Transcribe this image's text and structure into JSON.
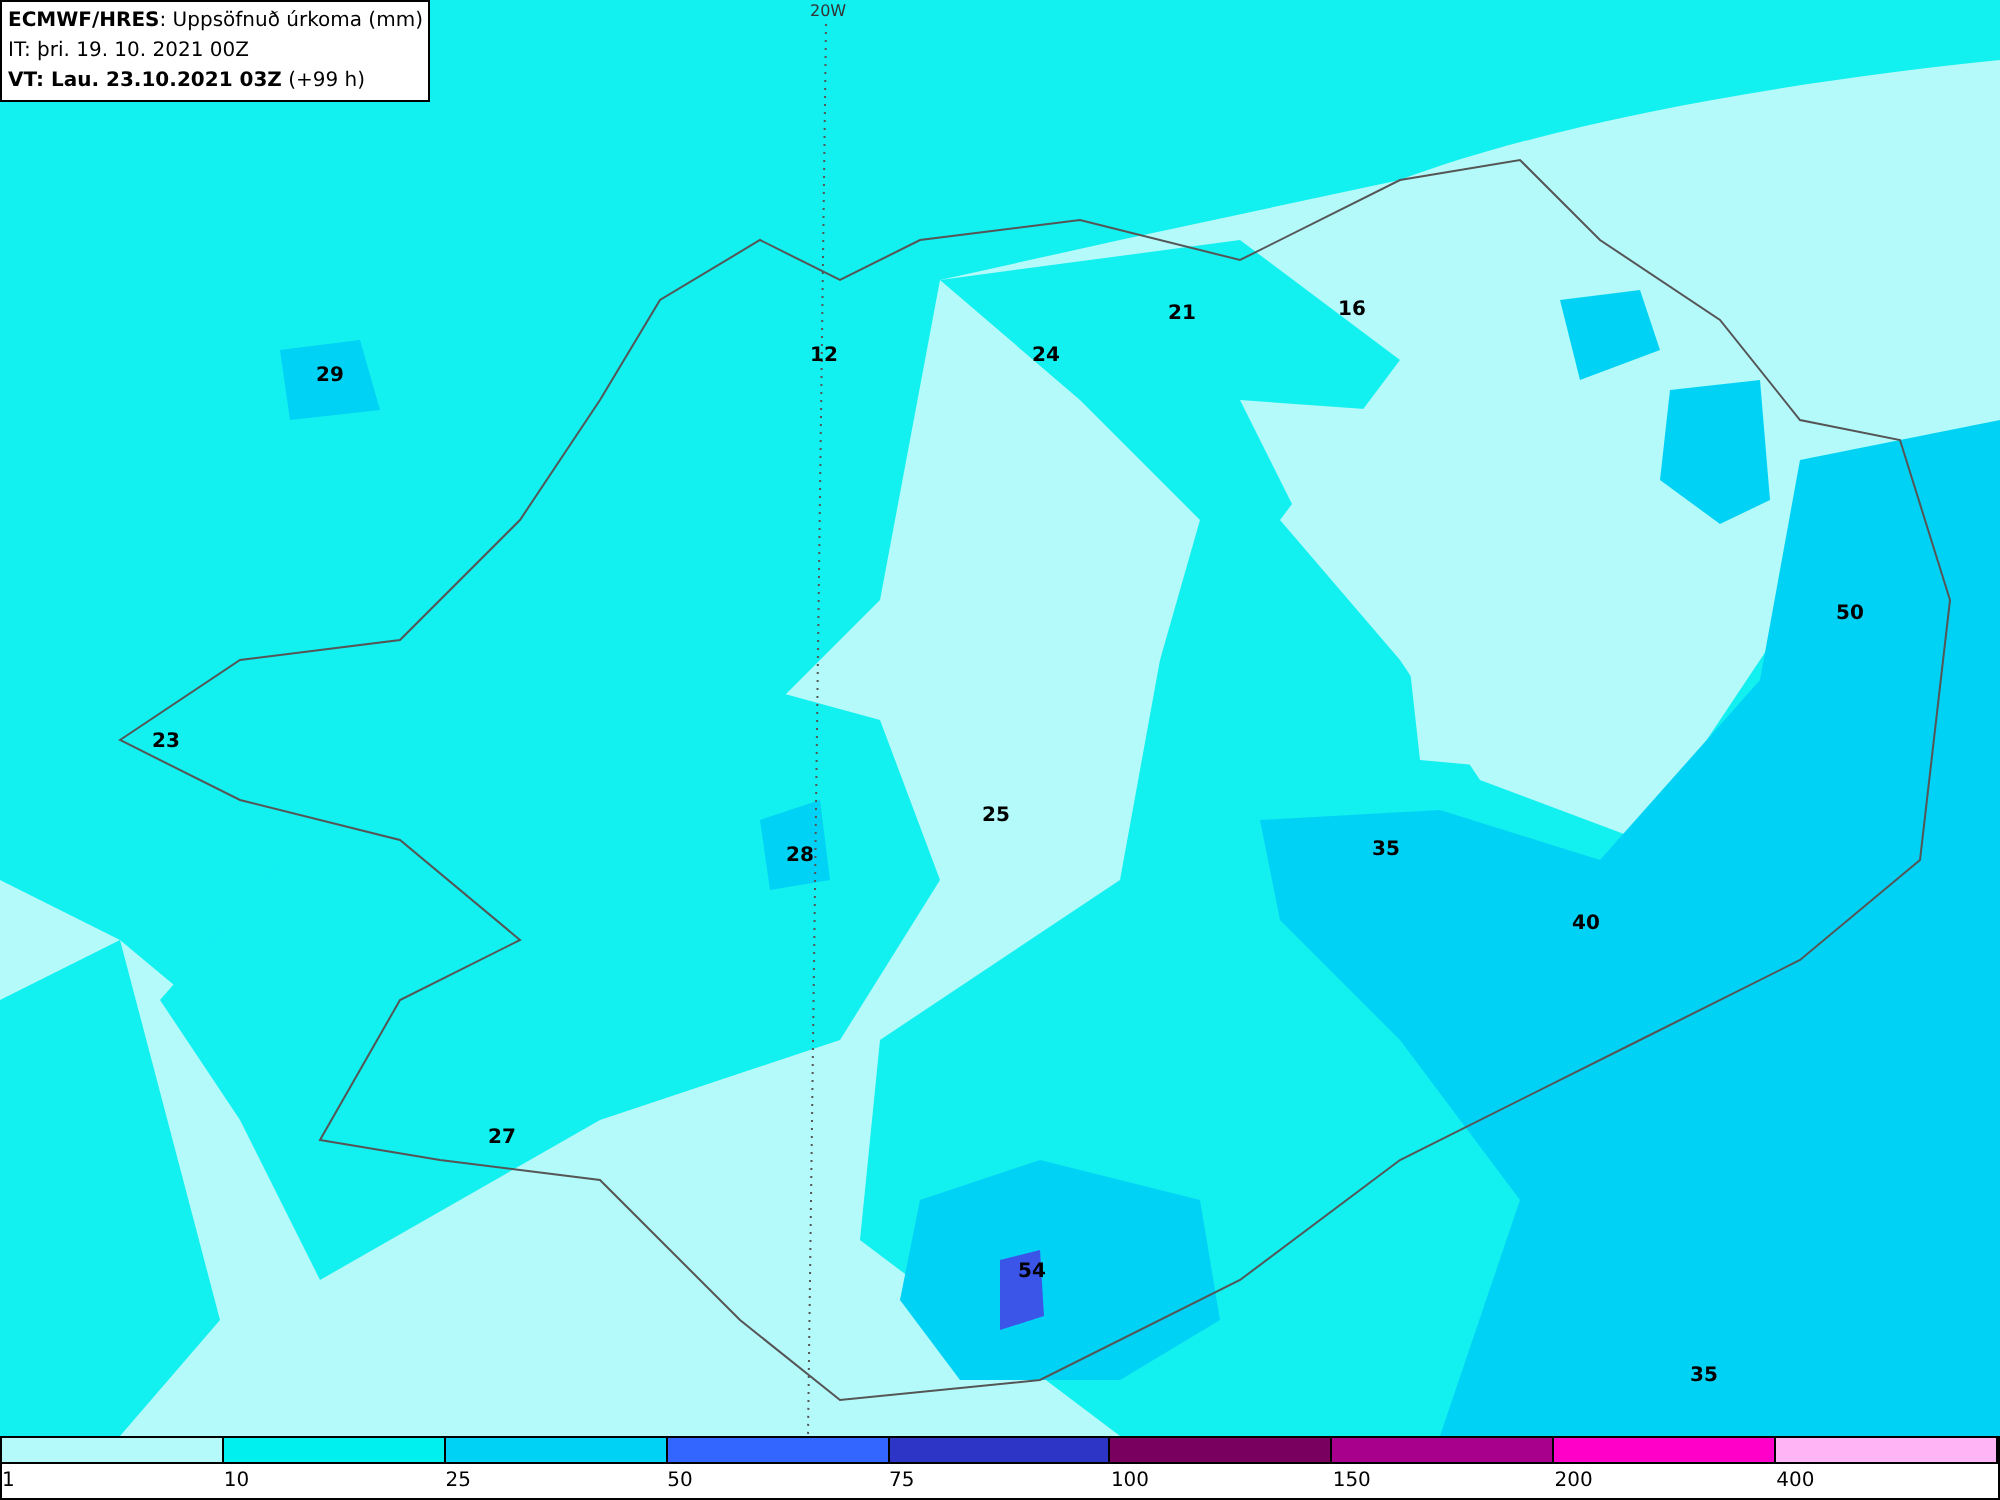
{
  "header": {
    "lines": [
      "**ECMWF/HRES**: Uppsöfnuð úrkoma (mm)",
      "IT: þri. 19. 10. 2021 00Z",
      "**VT: Lau. 23.10.2021 03Z** (+99 h)"
    ]
  },
  "map": {
    "meridian_label": "20W",
    "value_labels": [
      "29",
      "12",
      "24",
      "21",
      "16",
      "50",
      "23",
      "25",
      "28",
      "35",
      "40",
      "27",
      "54",
      "35"
    ]
  },
  "legend": [
    {
      "label": "1",
      "color": "#b4fafa"
    },
    {
      "label": "10",
      "color": "#00f0f0"
    },
    {
      "label": "25",
      "color": "#00d2f5"
    },
    {
      "label": "50",
      "color": "#3366ff"
    },
    {
      "label": "75",
      "color": "#2d35c6"
    },
    {
      "label": "100",
      "color": "#7a0060"
    },
    {
      "label": "150",
      "color": "#a8008c"
    },
    {
      "label": "200",
      "color": "#ff00c8"
    },
    {
      "label": "400",
      "color": "#ffb4f5"
    }
  ]
}
